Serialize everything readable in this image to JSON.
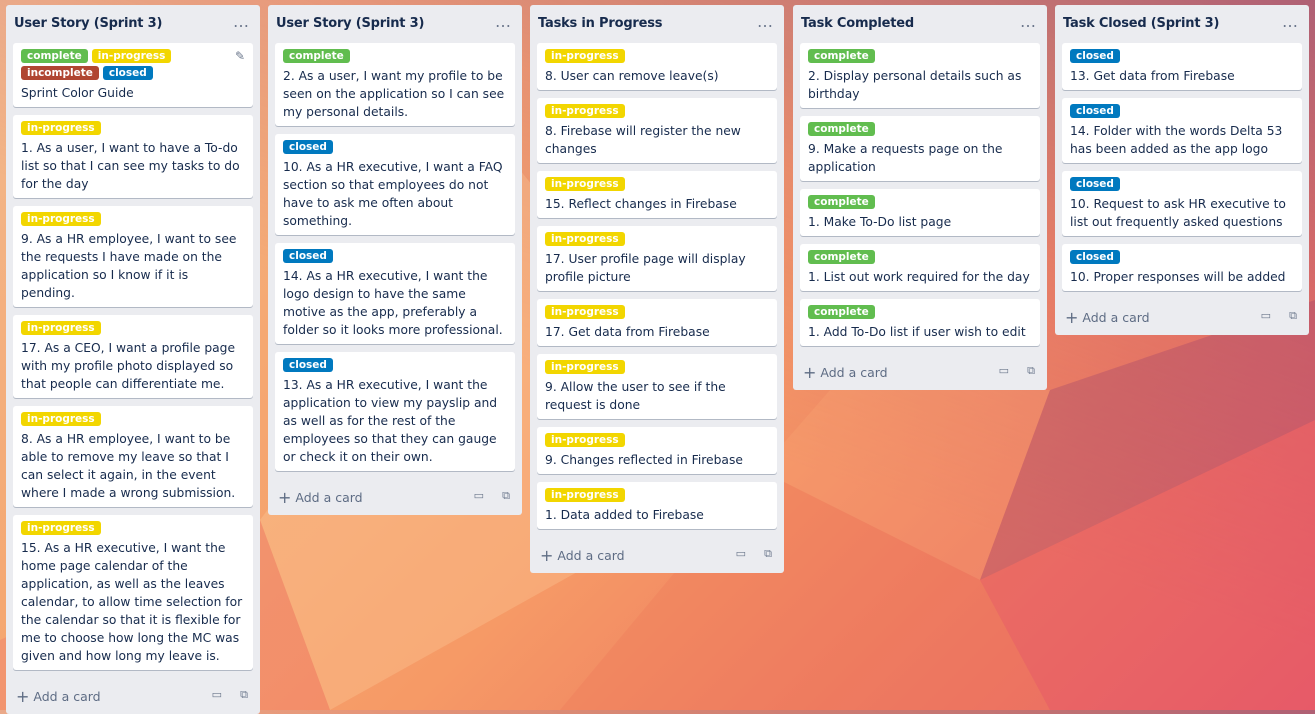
{
  "colors": {
    "complete": "#61bd4f",
    "in-progress": "#f2d600",
    "incomplete": "#b04632",
    "closed": "#0079bf"
  },
  "footer": {
    "add_card_label": "Add a card"
  },
  "lists": [
    {
      "title": "User Story (Sprint 3)",
      "cards": [
        {
          "labels": [
            {
              "text": "complete",
              "type": "complete"
            },
            {
              "text": "in-progress",
              "type": "in-progress"
            },
            {
              "text": "incomplete",
              "type": "incomplete"
            },
            {
              "text": "closed",
              "type": "closed"
            }
          ],
          "title": "Sprint Color Guide",
          "edit": true
        },
        {
          "labels": [
            {
              "text": "in-progress",
              "type": "in-progress"
            }
          ],
          "title": "1. As a user, I want to have a To-do list so that I can see my tasks to do for the day"
        },
        {
          "labels": [
            {
              "text": "in-progress",
              "type": "in-progress"
            }
          ],
          "title": "9. As a HR employee, I want to see the requests I have made on the application so I know if it is pending."
        },
        {
          "labels": [
            {
              "text": "in-progress",
              "type": "in-progress"
            }
          ],
          "title": "17. As a CEO, I want a profile page with my profile photo displayed so that people can differentiate me."
        },
        {
          "labels": [
            {
              "text": "in-progress",
              "type": "in-progress"
            }
          ],
          "title": "8. As a HR employee, I want to be able to remove my leave so that I can select it again, in the event where I made a wrong submission."
        },
        {
          "labels": [
            {
              "text": "in-progress",
              "type": "in-progress"
            }
          ],
          "title": "15. As a HR executive, I want the home page calendar of the application, as well as the leaves calendar, to allow time selection for the calendar so that it is flexible for me to choose how long the MC was given and how long my leave is."
        }
      ]
    },
    {
      "title": "User Story (Sprint 3)",
      "cards": [
        {
          "labels": [
            {
              "text": "complete",
              "type": "complete"
            }
          ],
          "title": "2. As a user, I want my profile to be seen on the application so I can see my personal details."
        },
        {
          "labels": [
            {
              "text": "closed",
              "type": "closed"
            }
          ],
          "title": "10. As a HR executive, I want a FAQ section so that employees do not have to ask me often about something."
        },
        {
          "labels": [
            {
              "text": "closed",
              "type": "closed"
            }
          ],
          "title": "14. As a HR executive, I want the logo design to have the same motive as the app, preferably a folder so it looks more professional."
        },
        {
          "labels": [
            {
              "text": "closed",
              "type": "closed"
            }
          ],
          "title": "13. As a HR executive, I want the application to view my payslip and as well as for the rest of the employees so that they can gauge or check it on their own."
        }
      ]
    },
    {
      "title": "Tasks in Progress",
      "cards": [
        {
          "labels": [
            {
              "text": "in-progress",
              "type": "in-progress"
            }
          ],
          "title": "8. User can remove leave(s)"
        },
        {
          "labels": [
            {
              "text": "in-progress",
              "type": "in-progress"
            }
          ],
          "title": "8. Firebase will register the new changes"
        },
        {
          "labels": [
            {
              "text": "in-progress",
              "type": "in-progress"
            }
          ],
          "title": "15. Reflect changes in Firebase"
        },
        {
          "labels": [
            {
              "text": "in-progress",
              "type": "in-progress"
            }
          ],
          "title": "17. User profile page will display profile picture"
        },
        {
          "labels": [
            {
              "text": "in-progress",
              "type": "in-progress"
            }
          ],
          "title": "17. Get data from Firebase"
        },
        {
          "labels": [
            {
              "text": "in-progress",
              "type": "in-progress"
            }
          ],
          "title": "9. Allow the user to see if the request is done"
        },
        {
          "labels": [
            {
              "text": "in-progress",
              "type": "in-progress"
            }
          ],
          "title": "9. Changes reflected in Firebase"
        },
        {
          "labels": [
            {
              "text": "in-progress",
              "type": "in-progress"
            }
          ],
          "title": "1. Data added to Firebase"
        }
      ]
    },
    {
      "title": "Task Completed",
      "cards": [
        {
          "labels": [
            {
              "text": "complete",
              "type": "complete"
            }
          ],
          "title": "2. Display personal details such as birthday"
        },
        {
          "labels": [
            {
              "text": "complete",
              "type": "complete"
            }
          ],
          "title": "9. Make a requests page on the application"
        },
        {
          "labels": [
            {
              "text": "complete",
              "type": "complete"
            }
          ],
          "title": "1. Make To-Do list page"
        },
        {
          "labels": [
            {
              "text": "complete",
              "type": "complete"
            }
          ],
          "title": "1. List out work required for the day"
        },
        {
          "labels": [
            {
              "text": "complete",
              "type": "complete"
            }
          ],
          "title": "1. Add To-Do list if user wish to edit"
        }
      ]
    },
    {
      "title": "Task Closed (Sprint 3)",
      "cards": [
        {
          "labels": [
            {
              "text": "closed",
              "type": "closed"
            }
          ],
          "title": "13. Get data from Firebase"
        },
        {
          "labels": [
            {
              "text": "closed",
              "type": "closed"
            }
          ],
          "title": "14. Folder with the words Delta 53 has been added as the app logo"
        },
        {
          "labels": [
            {
              "text": "closed",
              "type": "closed"
            }
          ],
          "title": "10. Request to ask HR executive to list out frequently asked questions"
        },
        {
          "labels": [
            {
              "text": "closed",
              "type": "closed"
            }
          ],
          "title": "10. Proper responses will be added"
        }
      ]
    }
  ]
}
